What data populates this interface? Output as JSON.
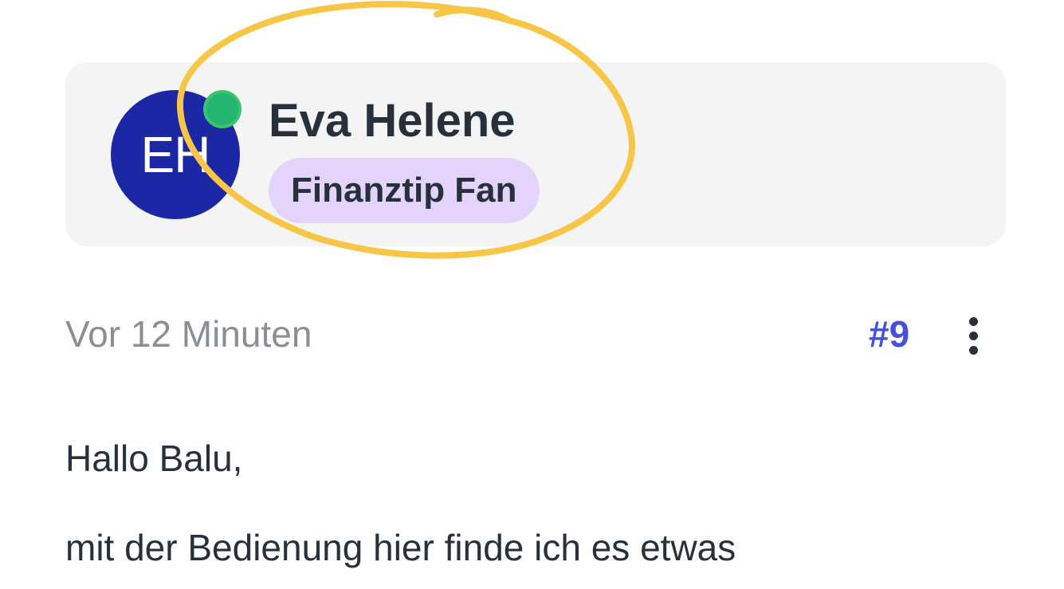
{
  "post": {
    "author": {
      "initials": "EH",
      "name": "Eva Helene",
      "role": "Finanztip Fan",
      "online": true
    },
    "timestamp": "Vor 12 Minuten",
    "number": "#9",
    "body": [
      "Hallo Balu,",
      "mit der Bedienung hier finde ich es etwas"
    ]
  },
  "colors": {
    "avatar_bg": "#1b27a5",
    "online_dot": "#21b56f",
    "badge_bg": "#e4d4fb",
    "accent": "#4452d9",
    "highlight": "#f7c646"
  },
  "icons": {
    "online": "online-status-dot",
    "menu": "vertical-ellipsis"
  }
}
